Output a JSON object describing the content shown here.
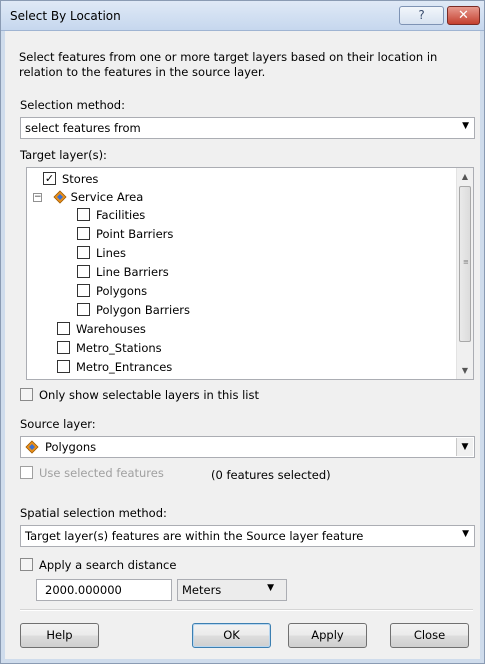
{
  "window": {
    "title": "Select By Location",
    "help_glyph": "?",
    "close_glyph": "✕"
  },
  "description": "Select features from one or more target layers based on their location in relation to the features in the source layer.",
  "selection_method": {
    "label": "Selection method:",
    "value": "select features from"
  },
  "target_layers": {
    "label": "Target layer(s):",
    "items": [
      {
        "label": "Stores",
        "checked": true
      },
      {
        "label": "Service Area",
        "group": true
      },
      {
        "label": "Facilities",
        "checked": false
      },
      {
        "label": "Point Barriers",
        "checked": false
      },
      {
        "label": "Lines",
        "checked": false
      },
      {
        "label": "Line Barriers",
        "checked": false
      },
      {
        "label": "Polygons",
        "checked": false
      },
      {
        "label": "Polygon Barriers",
        "checked": false
      },
      {
        "label": "Warehouses",
        "checked": false
      },
      {
        "label": "Metro_Stations",
        "checked": false
      },
      {
        "label": "Metro_Entrances",
        "checked": false
      }
    ]
  },
  "only_selectable": {
    "label": "Only show selectable layers in this list",
    "checked": false
  },
  "source_layer": {
    "label": "Source layer:",
    "value": "Polygons"
  },
  "use_selected": {
    "label": "Use selected features",
    "checked": false,
    "enabled": false,
    "count_text": "(0 features selected)"
  },
  "spatial_method": {
    "label": "Spatial selection method:",
    "value": "Target layer(s) features are within the Source layer feature"
  },
  "search_distance": {
    "label": "Apply a search distance",
    "checked": false,
    "value": "2000.000000",
    "unit": "Meters"
  },
  "buttons": {
    "help": "Help",
    "ok": "OK",
    "apply": "Apply",
    "close": "Close"
  },
  "colors": {
    "titlebar": "#c6d7ee",
    "dialog_bg": "#f0f0f0",
    "close_button": "#c4402f",
    "layer_icon_orange": "#e8901c",
    "layer_icon_blue": "#3a6fd0"
  }
}
